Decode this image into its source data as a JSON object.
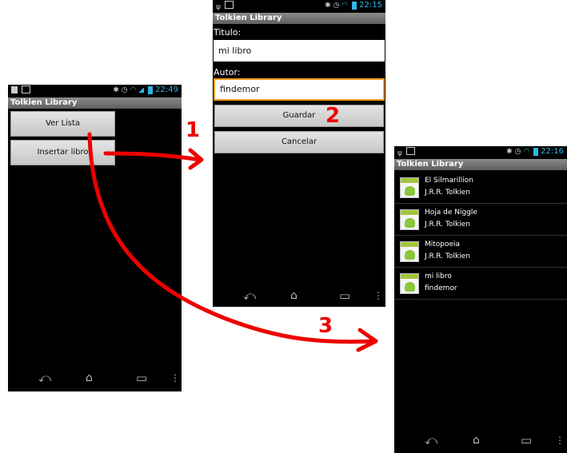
{
  "screen1": {
    "status_time": "22:49",
    "app_title": "Tolkien Library",
    "buttons": [
      "Ver Lista",
      "Insertar libro"
    ]
  },
  "screen2": {
    "status_time": "22:15",
    "app_title": "Tolkien Library",
    "titulo_label": "Titulo:",
    "titulo_value": "mi libro",
    "autor_label": "Autor:",
    "autor_value": "findemor",
    "guardar_label": "Guardar",
    "cancelar_label": "Cancelar"
  },
  "screen3": {
    "status_time": "22:16",
    "app_title": "Tolkien Library",
    "books": [
      {
        "title": "El Silmarillion",
        "author": "J.R.R. Tolkien"
      },
      {
        "title": "Hoja de Niggle",
        "author": "J.R.R. Tolkien"
      },
      {
        "title": "Mitopoeia",
        "author": "J.R.R. Tolkien"
      },
      {
        "title": "mi libro",
        "author": "findemor"
      }
    ]
  },
  "annotations": {
    "step1": "1",
    "step2": "2",
    "step3": "3",
    "arrow_color": "#ee0000"
  },
  "icons": [
    "facebook-icon",
    "image-icon",
    "bluetooth-icon",
    "alarm-icon",
    "wifi-icon",
    "signal-icon",
    "battery-icon",
    "usb-icon",
    "back-icon",
    "home-icon",
    "recent-apps-icon",
    "overflow-menu-icon",
    "android-app-icon"
  ],
  "accent_color": "#33b5e5",
  "focus_color": "#ff9a1c"
}
